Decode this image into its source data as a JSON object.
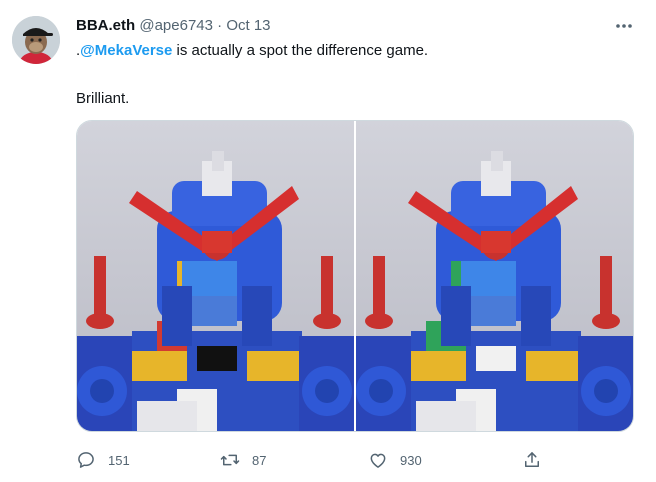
{
  "tweet": {
    "display_name": "BBA.eth",
    "handle": "@ape6743",
    "separator": "·",
    "date": "Oct 13",
    "text_prefix": ".",
    "mention": "@MekaVerse",
    "text_suffix": " is actually a spot the difference game.",
    "text_second": "Brilliant."
  },
  "actions": {
    "reply_count": "151",
    "retweet_count": "87",
    "like_count": "930"
  },
  "icons": {
    "more": "more-horizontal-icon",
    "reply": "reply-bubble-icon",
    "retweet": "retweet-arrows-icon",
    "like": "heart-icon",
    "share": "share-upload-icon"
  },
  "colors": {
    "link": "#1d9bf0",
    "secondary_text": "#536471",
    "border": "#cfd9de"
  }
}
